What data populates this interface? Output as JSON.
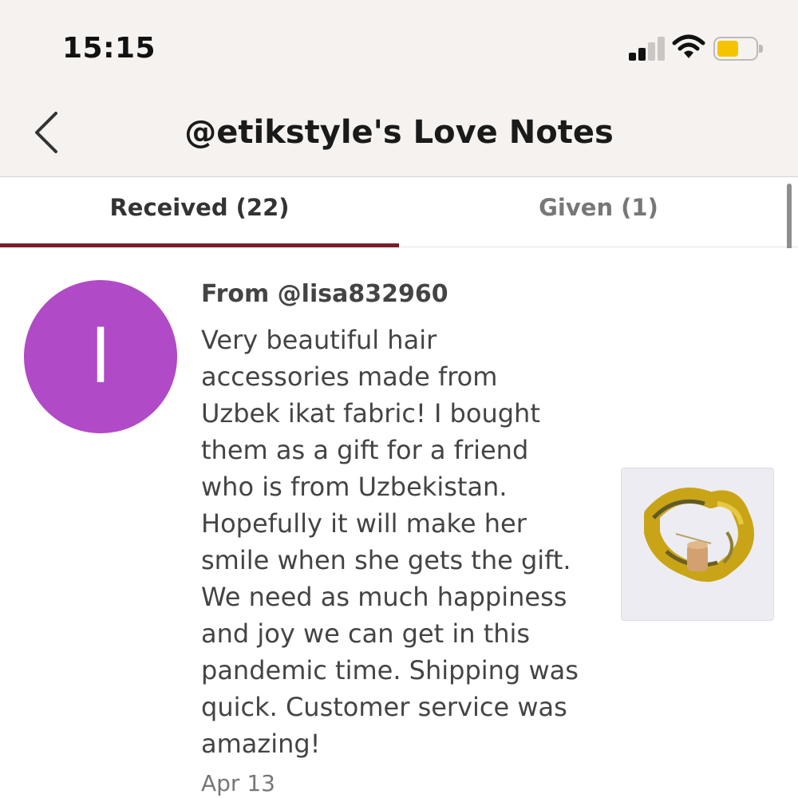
{
  "status_bar": {
    "time": "15:15",
    "icons": [
      "cellular-signal-icon",
      "wifi-icon",
      "battery-icon"
    ],
    "battery_color": "#f5c400"
  },
  "header": {
    "back_icon": "chevron-left-icon",
    "title": "@etikstyle's Love Notes"
  },
  "tabs": [
    {
      "label": "Received (22)",
      "active": true
    },
    {
      "label": "Given (1)",
      "active": false
    }
  ],
  "colors": {
    "accent": "#7a1c2a",
    "avatar": "#b04ac6",
    "header_bg": "#f6f2ef"
  },
  "notes": [
    {
      "avatar_letter": "l",
      "from": "From @lisa832960",
      "message": "Very beautiful hair\naccessories made from\nUzbek ikat fabric! I bought\nthem as a gift for a friend\nwho is from Uzbekistan.\nHopefully it will make her\nsmile when she gets the gift.\nWe need as much happiness\nand joy we can get in this\npandemic time. Shipping was\nquick. Customer service was\namazing!",
      "date": "Apr 13",
      "thumbnail": "product-photo-yellow-ikat-hair-accessory"
    }
  ]
}
